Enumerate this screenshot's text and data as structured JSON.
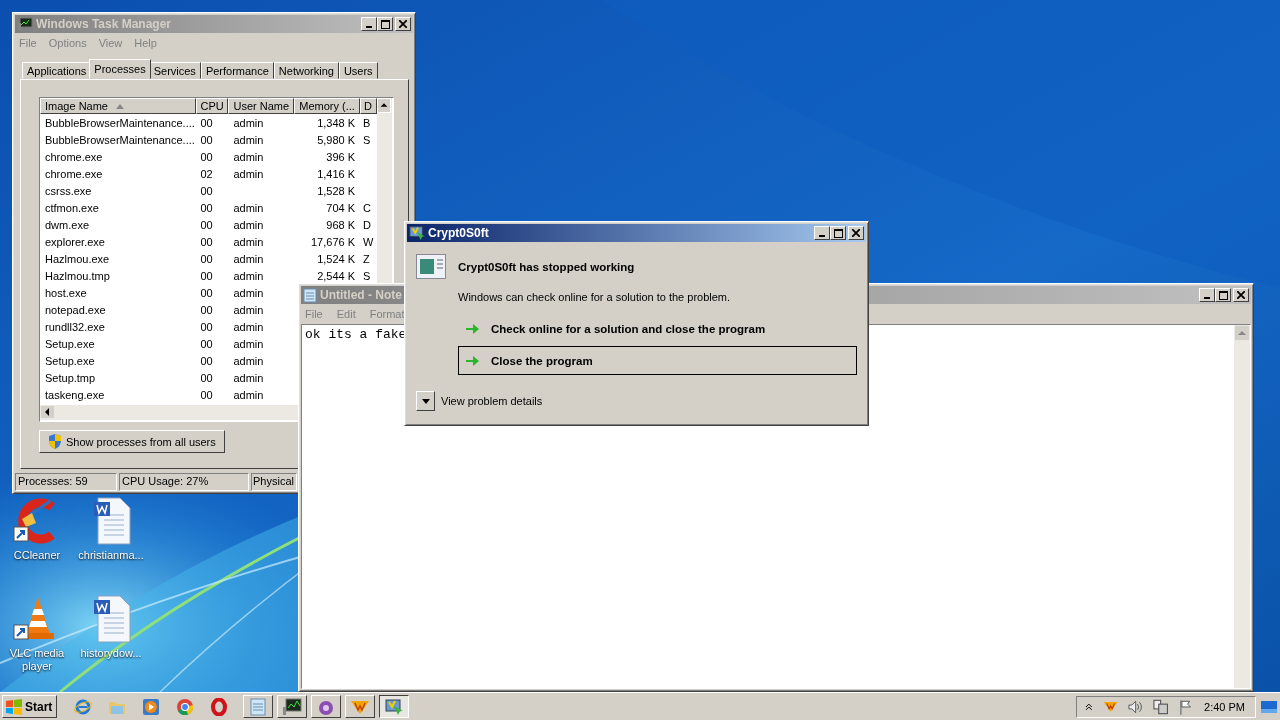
{
  "desktop_icons": [
    {
      "kind": "ccleaner",
      "label": "CCleaner"
    },
    {
      "kind": "document",
      "label": "christianma..."
    },
    {
      "kind": "vlc",
      "label": "VLC media player"
    },
    {
      "kind": "document",
      "label": "historydow..."
    }
  ],
  "task_manager": {
    "title": "Windows Task Manager",
    "menu": [
      "File",
      "Options",
      "View",
      "Help"
    ],
    "tabs": [
      {
        "label": "Applications",
        "selected": false
      },
      {
        "label": "Processes",
        "selected": true
      },
      {
        "label": "Services",
        "selected": false
      },
      {
        "label": "Performance",
        "selected": false
      },
      {
        "label": "Networking",
        "selected": false
      },
      {
        "label": "Users",
        "selected": false
      }
    ],
    "columns": [
      {
        "label": "Image Name",
        "sorted": true
      },
      {
        "label": "CPU",
        "sorted": false
      },
      {
        "label": "User Name",
        "sorted": false
      },
      {
        "label": "Memory (...",
        "sorted": false
      },
      {
        "label": "D",
        "sorted": false
      }
    ],
    "rows": [
      {
        "image_name": "BubbleBrowserMaintenance....",
        "cpu": "00",
        "user_name": "admin",
        "memory": "1,348 K",
        "column_5": "B"
      },
      {
        "image_name": "BubbleBrowserMaintenance....",
        "cpu": "00",
        "user_name": "admin",
        "memory": "5,980 K",
        "column_5": "S"
      },
      {
        "image_name": "chrome.exe",
        "cpu": "00",
        "user_name": "admin",
        "memory": "396 K"
      },
      {
        "image_name": "chrome.exe",
        "cpu": "02",
        "user_name": "admin",
        "memory": "1,416 K"
      },
      {
        "image_name": "csrss.exe",
        "cpu": "00",
        "memory": "1,528 K"
      },
      {
        "image_name": "ctfmon.exe",
        "cpu": "00",
        "user_name": "admin",
        "memory": "704 K",
        "column_5": "C"
      },
      {
        "image_name": "dwm.exe",
        "cpu": "00",
        "user_name": "admin",
        "memory": "968 K",
        "column_5": "D"
      },
      {
        "image_name": "explorer.exe",
        "cpu": "00",
        "user_name": "admin",
        "memory": "17,676 K",
        "column_5": "W"
      },
      {
        "image_name": "Hazlmou.exe",
        "cpu": "00",
        "user_name": "admin",
        "memory": "1,524 K",
        "column_5": "Z"
      },
      {
        "image_name": "Hazlmou.tmp",
        "cpu": "00",
        "user_name": "admin",
        "memory": "2,544 K",
        "column_5": "S"
      },
      {
        "image_name": "host.exe",
        "cpu": "00",
        "user_name": "admin"
      },
      {
        "image_name": "notepad.exe",
        "cpu": "00",
        "user_name": "admin"
      },
      {
        "image_name": "rundll32.exe",
        "cpu": "00",
        "user_name": "admin"
      },
      {
        "image_name": "Setup.exe",
        "cpu": "00",
        "user_name": "admin"
      },
      {
        "image_name": "Setup.exe",
        "cpu": "00",
        "user_name": "admin"
      },
      {
        "image_name": "Setup.tmp",
        "cpu": "00",
        "user_name": "admin"
      },
      {
        "image_name": "taskeng.exe",
        "cpu": "00",
        "user_name": "admin"
      }
    ],
    "show_all_button": "Show processes from all users",
    "status_bar": [
      "Processes: 59",
      "CPU Usage: 27%",
      "Physical"
    ]
  },
  "notepad": {
    "title": "Untitled - Note",
    "menu": [
      "File",
      "Edit",
      "Format"
    ],
    "text": "ok its a fake"
  },
  "dialog": {
    "title": "Crypt0S0ft",
    "heading": "Crypt0S0ft has stopped working",
    "message": "Windows can check online for a solution to the problem.",
    "options": [
      {
        "label": "Check online for a solution and close the program",
        "selected": false
      },
      {
        "label": "Close the program",
        "selected": true
      }
    ],
    "details": "View problem details"
  },
  "taskbar": {
    "start": "Start",
    "quick_launch": [
      {
        "kind": "browser-e"
      },
      {
        "kind": "folder"
      },
      {
        "kind": "player"
      },
      {
        "kind": "chrome"
      },
      {
        "kind": "ring"
      }
    ],
    "apps": [
      {
        "kind": "notepad",
        "active": false
      },
      {
        "kind": "monitor",
        "active": false
      },
      {
        "kind": "orb",
        "active": false
      },
      {
        "kind": "shield",
        "active": false
      },
      {
        "kind": "app",
        "active": true
      }
    ],
    "clock": "2:40 PM"
  }
}
